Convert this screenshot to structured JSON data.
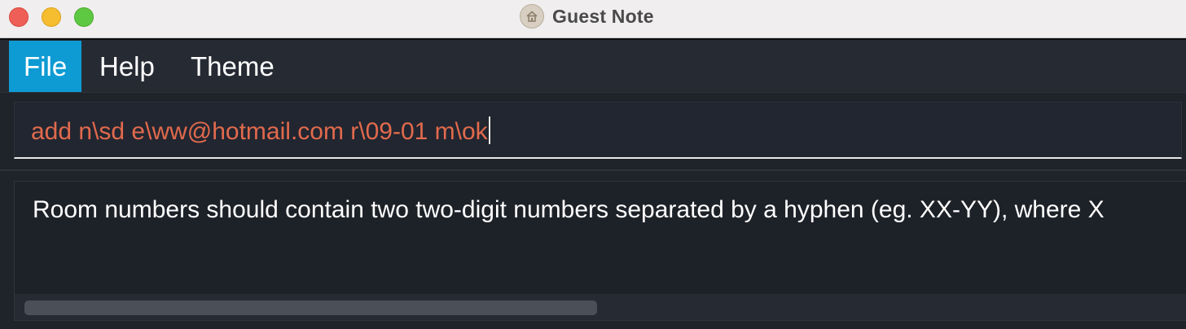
{
  "window": {
    "title": "Guest Note",
    "app_icon": "house-icon",
    "controls": [
      "close-button",
      "minimize-button",
      "zoom-button"
    ]
  },
  "menu": {
    "items": [
      {
        "label": "File",
        "selected": true
      },
      {
        "label": "Help",
        "selected": false
      },
      {
        "label": "Theme",
        "selected": false
      }
    ]
  },
  "command_box": {
    "value": "add n\\sd e\\ww@hotmail.com r\\09-01 m\\ok",
    "text_color": "#e26a4d"
  },
  "result_display": {
    "text": "Room numbers should contain two two-digit numbers separated by a hyphen (eg. XX-YY), where X"
  },
  "colors": {
    "accent": "#0e9bd3",
    "background": "#1f232a",
    "error_text": "#e26a4d"
  }
}
